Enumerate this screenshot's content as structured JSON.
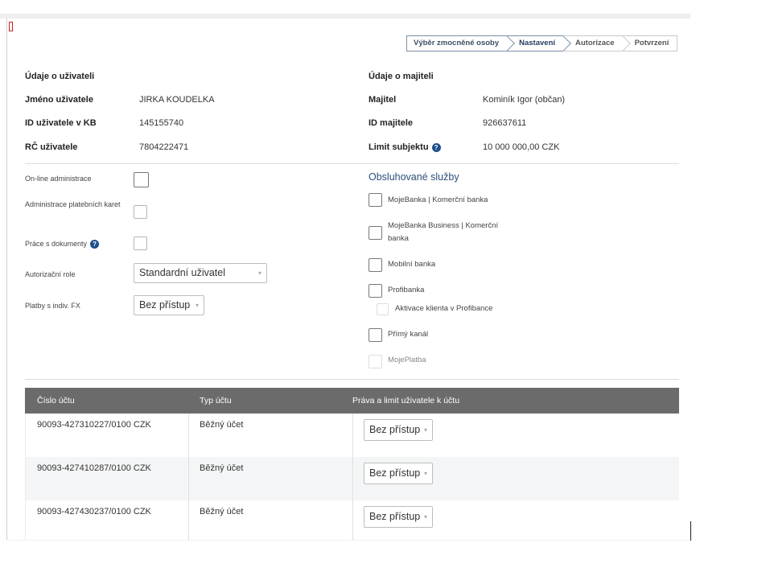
{
  "steps": [
    {
      "label": "Výběr zmocněné osoby"
    },
    {
      "label": "Nastavení"
    },
    {
      "label": "Autorizace"
    },
    {
      "label": "Potvrzení"
    }
  ],
  "user_info": {
    "heading": "Údaje o uživateli",
    "rows": [
      {
        "label": "Jméno uživatele",
        "value": "JIRKA KOUDELKA"
      },
      {
        "label": "ID uživatele v KB",
        "value": "145155740"
      },
      {
        "label": "RČ uživatele",
        "value": "7804222471"
      }
    ]
  },
  "owner_info": {
    "heading": "Údaje o majiteli",
    "rows": [
      {
        "label": "Majitel",
        "value": "Kominík Igor (občan)"
      },
      {
        "label": "ID majitele",
        "value": "926637611"
      },
      {
        "label": "Limit subjektu",
        "value": "10 000 000,00 CZK"
      }
    ]
  },
  "settings": {
    "online_admin": "On-line administrace",
    "card_admin": "Administrace platebních karet",
    "documents": "Práce s dokumenty",
    "auth_role": "Autorizační role",
    "auth_role_value": "Standardní uživatel",
    "fx_payments": "Platby s indiv. FX",
    "fx_value": "Bez přístup"
  },
  "services": {
    "title": "Obsluhované služby",
    "items": [
      "MojeBanka | Komerční banka",
      "MojeBanka Business | Komerční banka",
      "Mobilní banka",
      "Profibanka",
      "Aktivace klienta v Profibance",
      "Přímý kanál",
      "MojePlatba"
    ]
  },
  "accounts": {
    "columns": [
      "Číslo účtu",
      "Typ účtu",
      "Práva a limit uživatele k účtu"
    ],
    "rows": [
      {
        "number": "90093-427310227/0100 CZK",
        "type": "Běžný účet",
        "rights": "Bez přístup"
      },
      {
        "number": "90093-427410287/0100 CZK",
        "type": "Běžný účet",
        "rights": "Bez přístup"
      },
      {
        "number": "90093-427430237/0100 CZK",
        "type": "Běžný účet",
        "rights": "Bez přístup"
      }
    ]
  },
  "icons": {
    "help": "help-icon",
    "caret": "chevron-down-icon",
    "help_glyph": "?",
    "caret_glyph": "▾"
  },
  "colors": {
    "accent": "#1f4e8c",
    "table_header": "#6b6b6b",
    "step_active": "#1f3a5f"
  }
}
